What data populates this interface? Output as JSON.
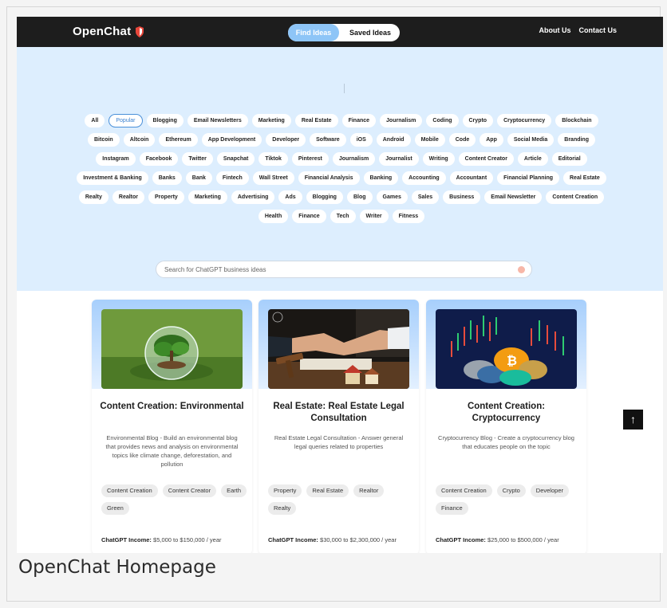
{
  "nav": {
    "logo": "OpenChat",
    "toggle": {
      "active": "Find Ideas",
      "other": "Saved Ideas"
    },
    "links": [
      "About Us",
      "Contact Us"
    ]
  },
  "hero": {
    "tags": [
      "All",
      "Popular",
      "Blogging",
      "Email Newsletters",
      "Marketing",
      "Real Estate",
      "Finance",
      "Journalism",
      "Coding",
      "Crypto",
      "Cryptocurrency",
      "Blockchain",
      "Bitcoin",
      "Altcoin",
      "Ethereum",
      "App Development",
      "Developer",
      "Software",
      "iOS",
      "Android",
      "Mobile",
      "Code",
      "App",
      "Social Media",
      "Branding",
      "Instagram",
      "Facebook",
      "Twitter",
      "Snapchat",
      "Tiktok",
      "Pinterest",
      "Journalism",
      "Journalist",
      "Writing",
      "Content Creator",
      "Article",
      "Editorial",
      "Investment & Banking",
      "Banks",
      "Bank",
      "Fintech",
      "Wall Street",
      "Financial Analysis",
      "Banking",
      "Accounting",
      "Accountant",
      "Financial Planning",
      "Real Estate",
      "Realty",
      "Realtor",
      "Property",
      "Marketing",
      "Advertising",
      "Ads",
      "Blogging",
      "Blog",
      "Games",
      "Sales",
      "Business",
      "Email Newsletter",
      "Content Creation",
      "Health",
      "Finance",
      "Tech",
      "Writer",
      "Fitness"
    ],
    "active_tag": "Popular",
    "search_placeholder": "Search for ChatGPT business ideas"
  },
  "cards": [
    {
      "title": "Content Creation: Environmental",
      "description": "Environmental Blog - Build an environmental blog that provides news and analysis on environmental topics like climate change, deforestation, and pollution",
      "tags": [
        "Content Creation",
        "Content Creator",
        "Earth",
        "Green"
      ],
      "income_label": "ChatGPT Income:",
      "income_value": "$5,000 to $150,000 / year",
      "image": "environment-globe-image"
    },
    {
      "title": "Real Estate: Real Estate Legal Consultation",
      "description": "Real Estate Legal Consultation - Answer general legal queries related to properties",
      "tags": [
        "Property",
        "Real Estate",
        "Realtor",
        "Realty"
      ],
      "income_label": "ChatGPT Income:",
      "income_value": "$30,000 to $2,300,000 / year",
      "image": "handshake-gavel-image"
    },
    {
      "title": "Content Creation: Cryptocurrency",
      "description": "Cryptocurrency Blog - Create a cryptocurrency blog that educates people on the topic",
      "tags": [
        "Content Creation",
        "Crypto",
        "Developer",
        "Finance"
      ],
      "income_label": "ChatGPT Income:",
      "income_value": "$25,000 to $500,000 / year",
      "image": "crypto-coins-chart-image"
    }
  ],
  "scroll_top_icon": "arrow-up-icon",
  "caption": "OpenChat Homepage",
  "colors": {
    "nav_bg": "#1d1d1d",
    "hero_bg": "#ddeefe",
    "accent": "#8ec5f7",
    "active_tag_border": "#4a90d9"
  }
}
